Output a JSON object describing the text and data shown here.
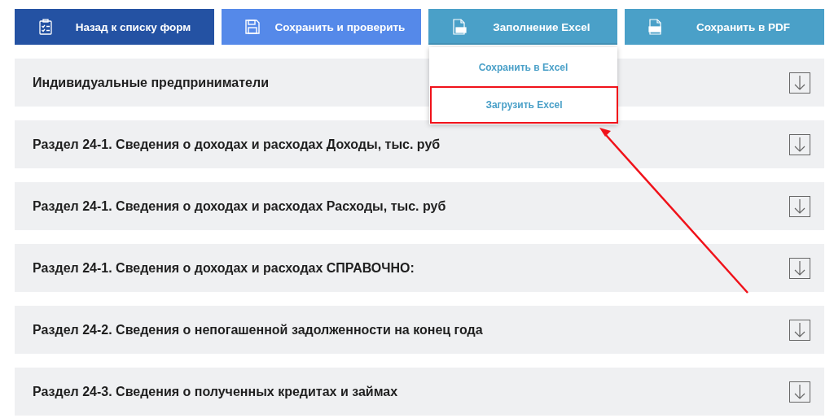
{
  "toolbar": [
    {
      "label": "Назад к списку форм",
      "kind": "clipboard",
      "color": "#2452a3"
    },
    {
      "label": "Сохранить и проверить",
      "kind": "floppy",
      "color": "#5589e9"
    },
    {
      "label": "Заполнение Excel",
      "kind": "xls",
      "color": "#4aa0c8",
      "expanded": true
    },
    {
      "label": "Сохранить в PDF",
      "kind": "pdf",
      "color": "#4aa0c8"
    }
  ],
  "dropdown": {
    "items": [
      {
        "label": "Сохранить в Excel",
        "highlighted": false
      },
      {
        "label": "Загрузить Excel",
        "highlighted": true
      }
    ]
  },
  "sections": [
    {
      "title": "Индивидуальные предприниматели",
      "expanded": false
    },
    {
      "title": "Раздел 24-1. Сведения о доходах и расходах Доходы, тыс. руб",
      "expanded": false
    },
    {
      "title": "Раздел 24-1. Сведения о доходах и расходах Расходы, тыс. руб",
      "expanded": false
    },
    {
      "title": "Раздел 24-1. Сведения о доходах и расходах СПРАВОЧНО:",
      "expanded": false
    },
    {
      "title": "Раздел 24-2. Сведения о непогашенной задолженности на конец года",
      "expanded": false
    },
    {
      "title": "Раздел 24-3. Сведения о полученных кредитах и займах",
      "expanded": false
    }
  ]
}
